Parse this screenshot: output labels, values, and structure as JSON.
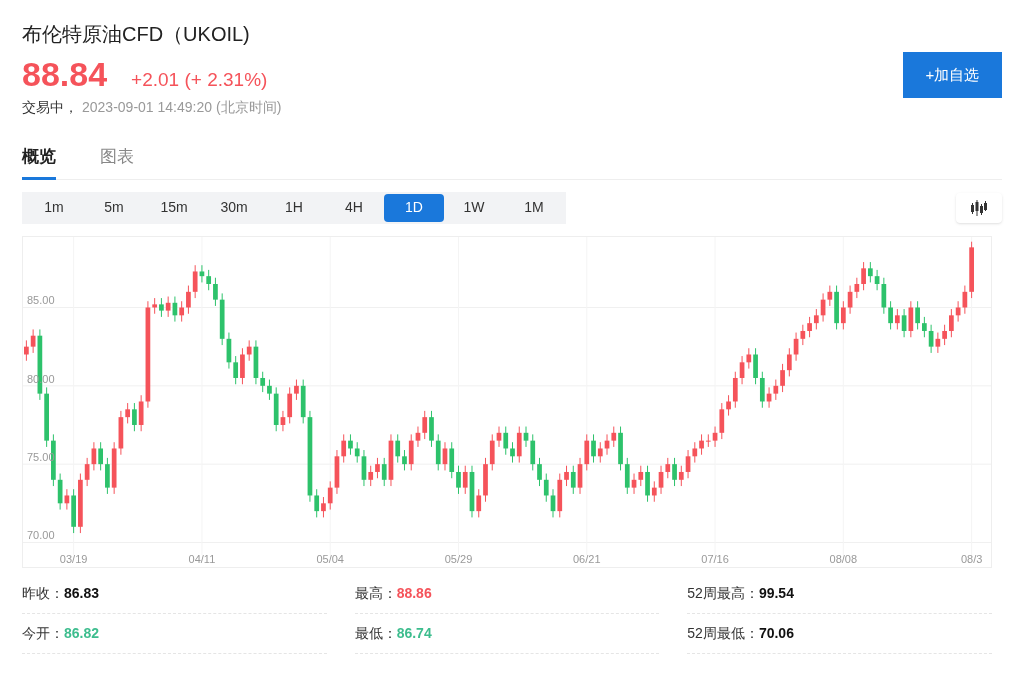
{
  "header": {
    "title": "布伦特原油CFD（UKOIL)",
    "price": "88.84",
    "change": "+2.01 (+ 2.31%)",
    "status": "交易中，",
    "time": "2023-09-01 14:49:20",
    "timezone": "(北京时间)",
    "button": "+加自选"
  },
  "tabs": [
    {
      "label": "概览",
      "selected": true
    },
    {
      "label": "图表",
      "selected": false
    }
  ],
  "intervals": [
    {
      "label": "1m",
      "selected": false
    },
    {
      "label": "5m",
      "selected": false
    },
    {
      "label": "15m",
      "selected": false
    },
    {
      "label": "30m",
      "selected": false
    },
    {
      "label": "1H",
      "selected": false
    },
    {
      "label": "4H",
      "selected": false
    },
    {
      "label": "1D",
      "selected": true
    },
    {
      "label": "1W",
      "selected": false
    },
    {
      "label": "1M",
      "selected": false
    }
  ],
  "candle_toggle": {
    "selected": true
  },
  "chart": {
    "chart_data": {
      "type": "candlestick",
      "grid": true,
      "ylim": [
        69.2,
        89.5
      ],
      "yticks": [
        {
          "value": 70,
          "label": "70.00"
        },
        {
          "value": 75,
          "label": "75.00"
        },
        {
          "value": 80,
          "label": "80.00"
        },
        {
          "value": 85,
          "label": "85.00"
        }
      ],
      "categories": [
        null,
        null,
        null,
        null,
        null,
        null,
        null,
        "03/19",
        null,
        null,
        null,
        null,
        null,
        null,
        null,
        null,
        null,
        null,
        null,
        null,
        null,
        null,
        null,
        null,
        null,
        null,
        "04/11",
        null,
        null,
        null,
        null,
        null,
        null,
        null,
        null,
        null,
        null,
        null,
        null,
        null,
        null,
        null,
        null,
        null,
        null,
        "05/04",
        null,
        null,
        null,
        null,
        null,
        null,
        null,
        null,
        null,
        null,
        null,
        null,
        null,
        null,
        null,
        null,
        null,
        null,
        "05/29",
        null,
        null,
        null,
        null,
        null,
        null,
        null,
        null,
        null,
        null,
        null,
        null,
        null,
        null,
        null,
        null,
        null,
        null,
        "06/21",
        null,
        null,
        null,
        null,
        null,
        null,
        null,
        null,
        null,
        null,
        null,
        null,
        null,
        null,
        null,
        null,
        null,
        null,
        "07/16",
        null,
        null,
        null,
        null,
        null,
        null,
        null,
        null,
        null,
        null,
        null,
        null,
        null,
        null,
        null,
        null,
        null,
        null,
        "08/08",
        null,
        null,
        null,
        null,
        null,
        null,
        null,
        null,
        null,
        null,
        null,
        null,
        null,
        null,
        null,
        null,
        null,
        null,
        "08/3"
      ],
      "ohlc": [
        [
          82,
          82.9,
          81.6,
          82.5
        ],
        [
          82.5,
          83.6,
          82.1,
          83.2
        ],
        [
          83.2,
          83.6,
          79.1,
          79.5
        ],
        [
          79.5,
          79.9,
          76.1,
          76.5
        ],
        [
          76.5,
          76.9,
          73.6,
          74
        ],
        [
          74,
          74.4,
          72.1,
          72.5
        ],
        [
          72.5,
          73.4,
          72.1,
          73
        ],
        [
          73,
          73.4,
          70.6,
          71
        ],
        [
          71,
          74.4,
          70.6,
          74
        ],
        [
          74,
          75.4,
          73.6,
          75
        ],
        [
          75,
          76.4,
          74.6,
          76
        ],
        [
          76,
          76.4,
          74.6,
          75
        ],
        [
          75,
          75.4,
          73.1,
          73.5
        ],
        [
          73.5,
          76.4,
          73.1,
          76
        ],
        [
          76,
          78.4,
          75.6,
          78
        ],
        [
          78,
          78.9,
          77.6,
          78.5
        ],
        [
          78.5,
          78.9,
          77.1,
          77.5
        ],
        [
          77.5,
          79.4,
          77.1,
          79
        ],
        [
          79,
          85.4,
          78.6,
          85
        ],
        [
          85,
          85.6,
          84.6,
          85.2
        ],
        [
          85.2,
          85.6,
          84.4,
          84.8
        ],
        [
          84.8,
          85.7,
          84.4,
          85.3
        ],
        [
          85.3,
          85.7,
          84.1,
          84.5
        ],
        [
          84.5,
          85.4,
          84.1,
          85
        ],
        [
          85,
          86.4,
          84.6,
          86
        ],
        [
          86,
          87.7,
          85.6,
          87.3
        ],
        [
          87.3,
          87.7,
          86.6,
          87
        ],
        [
          87,
          87.4,
          86.1,
          86.5
        ],
        [
          86.5,
          86.9,
          85.1,
          85.5
        ],
        [
          85.5,
          85.9,
          82.6,
          83
        ],
        [
          83,
          83.4,
          81.1,
          81.5
        ],
        [
          81.5,
          81.9,
          80.1,
          80.5
        ],
        [
          80.5,
          82.4,
          80.1,
          82
        ],
        [
          82,
          82.9,
          81.6,
          82.5
        ],
        [
          82.5,
          82.9,
          80.1,
          80.5
        ],
        [
          80.5,
          80.9,
          79.6,
          80
        ],
        [
          80,
          80.4,
          79.1,
          79.5
        ],
        [
          79.5,
          79.9,
          77.1,
          77.5
        ],
        [
          77.5,
          78.4,
          77.1,
          78
        ],
        [
          78,
          79.9,
          77.6,
          79.5
        ],
        [
          79.5,
          80.4,
          79.1,
          80
        ],
        [
          80,
          80.4,
          77.6,
          78
        ],
        [
          78,
          78.4,
          72.6,
          73
        ],
        [
          73,
          73.4,
          71.6,
          72
        ],
        [
          72,
          72.9,
          71.6,
          72.5
        ],
        [
          72.5,
          73.9,
          72.1,
          73.5
        ],
        [
          73.5,
          75.9,
          73.1,
          75.5
        ],
        [
          75.5,
          76.9,
          75.1,
          76.5
        ],
        [
          76.5,
          76.9,
          75.6,
          76
        ],
        [
          76,
          76.4,
          75.1,
          75.5
        ],
        [
          75.5,
          75.9,
          73.6,
          74
        ],
        [
          74,
          74.9,
          73.6,
          74.5
        ],
        [
          74.5,
          75.4,
          74.1,
          75
        ],
        [
          75,
          75.4,
          73.6,
          74
        ],
        [
          74,
          76.9,
          73.6,
          76.5
        ],
        [
          76.5,
          76.9,
          75.1,
          75.5
        ],
        [
          75.5,
          75.9,
          74.6,
          75
        ],
        [
          75,
          76.9,
          74.6,
          76.5
        ],
        [
          76.5,
          77.4,
          76.1,
          77
        ],
        [
          77,
          78.4,
          76.6,
          78
        ],
        [
          78,
          78.4,
          76.1,
          76.5
        ],
        [
          76.5,
          76.9,
          74.6,
          75
        ],
        [
          75,
          76.4,
          74.6,
          76
        ],
        [
          76,
          76.4,
          74.1,
          74.5
        ],
        [
          74.5,
          74.9,
          73.1,
          73.5
        ],
        [
          73.5,
          74.9,
          73.1,
          74.5
        ],
        [
          74.5,
          74.9,
          71.6,
          72
        ],
        [
          72,
          73.4,
          71.6,
          73
        ],
        [
          73,
          75.4,
          72.6,
          75
        ],
        [
          75,
          76.9,
          74.6,
          76.5
        ],
        [
          76.5,
          77.4,
          76.1,
          77
        ],
        [
          77,
          77.4,
          75.6,
          76
        ],
        [
          76,
          76.4,
          75.1,
          75.5
        ],
        [
          75.5,
          77.4,
          75.1,
          77
        ],
        [
          77,
          77.4,
          76.1,
          76.5
        ],
        [
          76.5,
          76.9,
          74.6,
          75
        ],
        [
          75,
          75.4,
          73.6,
          74
        ],
        [
          74,
          74.4,
          72.6,
          73
        ],
        [
          73,
          73.4,
          71.6,
          72
        ],
        [
          72,
          74.4,
          71.6,
          74
        ],
        [
          74,
          74.9,
          73.6,
          74.5
        ],
        [
          74.5,
          74.9,
          73.1,
          73.5
        ],
        [
          73.5,
          75.4,
          73.1,
          75
        ],
        [
          75,
          76.9,
          74.6,
          76.5
        ],
        [
          76.5,
          76.9,
          75.1,
          75.5
        ],
        [
          75.5,
          76.4,
          75.1,
          76
        ],
        [
          76,
          76.9,
          75.6,
          76.5
        ],
        [
          76.5,
          77.4,
          76.1,
          77
        ],
        [
          77,
          77.4,
          74.6,
          75
        ],
        [
          75,
          75.4,
          73.1,
          73.5
        ],
        [
          73.5,
          74.4,
          73.1,
          74
        ],
        [
          74,
          74.9,
          73.6,
          74.5
        ],
        [
          74.5,
          74.9,
          72.6,
          73
        ],
        [
          73,
          73.9,
          72.6,
          73.5
        ],
        [
          73.5,
          74.9,
          73.1,
          74.5
        ],
        [
          74.5,
          75.4,
          74.1,
          75
        ],
        [
          75,
          75.4,
          73.6,
          74
        ],
        [
          74,
          74.9,
          73.6,
          74.5
        ],
        [
          74.5,
          75.9,
          74.1,
          75.5
        ],
        [
          75.5,
          76.4,
          75.1,
          76
        ],
        [
          76,
          76.9,
          75.6,
          76.5
        ],
        [
          76.5,
          76.9,
          76.1,
          76.5
        ],
        [
          76.5,
          77.4,
          76.1,
          77
        ],
        [
          77,
          78.9,
          76.6,
          78.5
        ],
        [
          78.5,
          79.4,
          78.1,
          79
        ],
        [
          79,
          80.9,
          78.6,
          80.5
        ],
        [
          80.5,
          81.9,
          80.1,
          81.5
        ],
        [
          81.5,
          82.4,
          81.1,
          82
        ],
        [
          82,
          82.4,
          80.1,
          80.5
        ],
        [
          80.5,
          80.9,
          78.6,
          79
        ],
        [
          79,
          79.9,
          78.6,
          79.5
        ],
        [
          79.5,
          80.4,
          79.1,
          80
        ],
        [
          80,
          81.4,
          79.6,
          81
        ],
        [
          81,
          82.4,
          80.6,
          82
        ],
        [
          82,
          83.4,
          81.6,
          83
        ],
        [
          83,
          83.9,
          82.6,
          83.5
        ],
        [
          83.5,
          84.4,
          83.1,
          84
        ],
        [
          84,
          84.9,
          83.6,
          84.5
        ],
        [
          84.5,
          85.9,
          84.1,
          85.5
        ],
        [
          85.5,
          86.4,
          85.1,
          86
        ],
        [
          86,
          86.4,
          83.6,
          84
        ],
        [
          84,
          85.4,
          83.6,
          85
        ],
        [
          85,
          86.4,
          84.6,
          86
        ],
        [
          86,
          86.9,
          85.6,
          86.5
        ],
        [
          86.5,
          87.9,
          86.1,
          87.5
        ],
        [
          87.5,
          87.9,
          86.6,
          87
        ],
        [
          87,
          87.4,
          86.1,
          86.5
        ],
        [
          86.5,
          86.9,
          84.6,
          85
        ],
        [
          85,
          85.4,
          83.6,
          84
        ],
        [
          84,
          84.9,
          83.6,
          84.5
        ],
        [
          84.5,
          84.9,
          83.1,
          83.5
        ],
        [
          83.5,
          85.4,
          83.1,
          85
        ],
        [
          85,
          85.4,
          83.6,
          84
        ],
        [
          84,
          84.4,
          83.1,
          83.5
        ],
        [
          83.5,
          83.9,
          82.1,
          82.5
        ],
        [
          82.5,
          83.4,
          82.1,
          83
        ],
        [
          83,
          83.9,
          82.6,
          83.5
        ],
        [
          83.5,
          84.9,
          83.1,
          84.5
        ],
        [
          84.5,
          85.4,
          84.1,
          85
        ],
        [
          85,
          86.4,
          84.6,
          86
        ],
        [
          86,
          89.2,
          85.6,
          88.84
        ]
      ]
    }
  },
  "stats": [
    {
      "label": "昨收：",
      "value": "86.83",
      "color": "#111111"
    },
    {
      "label": "最高：",
      "value": "88.86",
      "color": "#f5535a"
    },
    {
      "label": "52周最高：",
      "value": "99.54",
      "color": "#111111"
    },
    {
      "label": "今开：",
      "value": "86.82",
      "color": "#3dbd8e"
    },
    {
      "label": "最低：",
      "value": "86.74",
      "color": "#3dbd8e"
    },
    {
      "label": "52周最低：",
      "value": "70.06",
      "color": "#111111"
    }
  ]
}
